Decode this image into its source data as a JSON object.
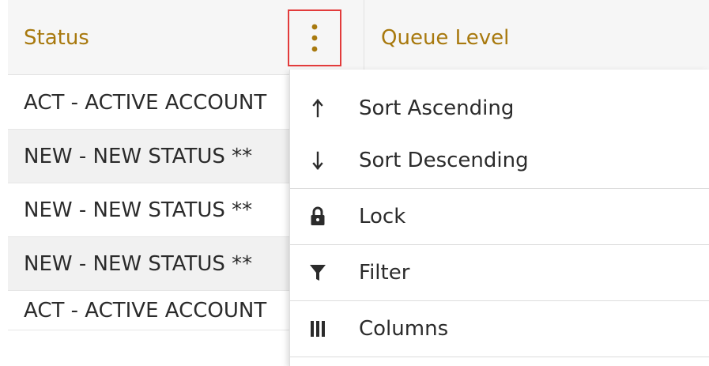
{
  "header": {
    "status_label": "Status",
    "queue_level_label": "Queue Level",
    "column_menu_icon": "vertical-ellipsis-icon",
    "accent_color": "#a8790e",
    "highlight_color": "#e23b3b"
  },
  "rows": [
    {
      "status": "ACT - ACTIVE ACCOUNT"
    },
    {
      "status": "NEW - NEW STATUS **"
    },
    {
      "status": "NEW - NEW STATUS **"
    },
    {
      "status": "NEW - NEW STATUS **"
    },
    {
      "status": "ACT - ACTIVE ACCOUNT"
    }
  ],
  "menu": {
    "items": [
      {
        "label": "Sort Ascending",
        "icon": "arrow-up-icon"
      },
      {
        "label": "Sort Descending",
        "icon": "arrow-down-icon"
      },
      {
        "label": "Lock",
        "icon": "lock-icon"
      },
      {
        "label": "Filter",
        "icon": "filter-icon"
      },
      {
        "label": "Columns",
        "icon": "columns-icon"
      }
    ]
  }
}
